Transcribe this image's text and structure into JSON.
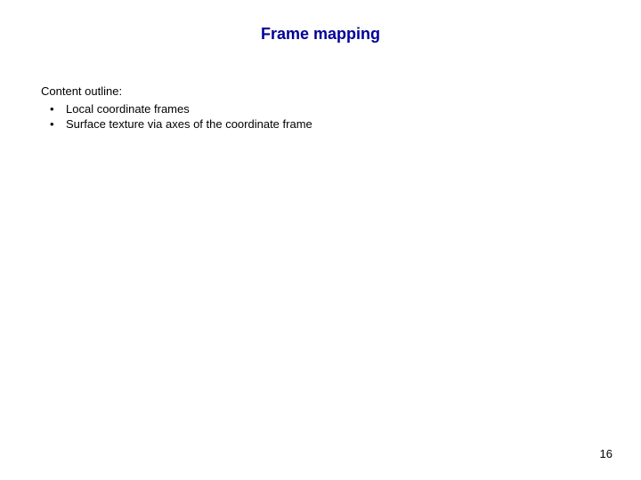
{
  "title": "Frame mapping",
  "outline_label": "Content outline:",
  "bullets": {
    "0": "Local coordinate frames",
    "1": "Surface texture via axes of the coordinate frame"
  },
  "page_number": "16"
}
